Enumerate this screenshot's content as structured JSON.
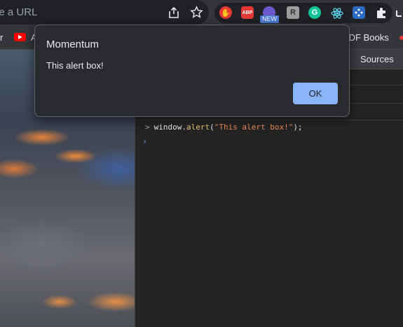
{
  "omnibox": {
    "text": "pe a URL"
  },
  "extensions": {
    "hand": "✋",
    "abp": "ABP",
    "new_badge": "NEW",
    "r_label": "R",
    "g_label": "G"
  },
  "bookmarks": {
    "item_r": "r",
    "item_a": "A",
    "item_pdf": "PDF Books"
  },
  "devtools": {
    "tab_sources": "Sources",
    "console": {
      "object": "window",
      "dot": ".",
      "method": "alert",
      "open": "(",
      "string": "\"This alert box!\"",
      "close": ");",
      "prompt": "›"
    }
  },
  "alert": {
    "title": "Momentum",
    "message": "This alert box!",
    "ok_label": "OK"
  },
  "colors": {
    "accent": "#8ab4f8",
    "dialog_bg": "#292a2d",
    "console_string": "#f28b54",
    "console_method": "#f0c674"
  }
}
